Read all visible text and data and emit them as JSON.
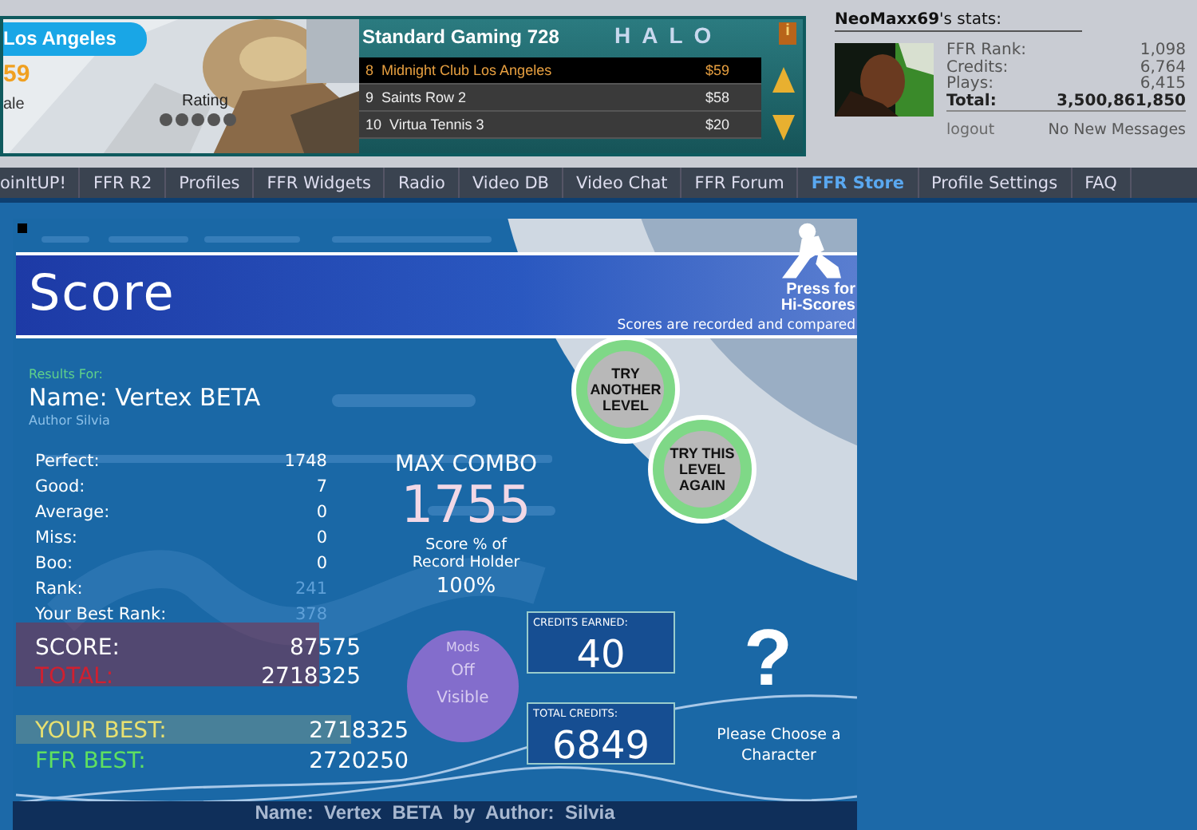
{
  "ad": {
    "tab": "Los Angeles",
    "price": "59",
    "caption": "ale",
    "rating_label": "Rating",
    "stars": 5,
    "title": "Standard Gaming 728",
    "logo": "HALO",
    "info": "i",
    "items": [
      {
        "rank": "8",
        "title": "Midnight Club Los Angeles",
        "price": "$59",
        "selected": true
      },
      {
        "rank": "9",
        "title": "Saints Row 2",
        "price": "$58",
        "selected": false
      },
      {
        "rank": "10",
        "title": "Virtua Tennis 3",
        "price": "$20",
        "selected": false
      }
    ]
  },
  "stats": {
    "heading": "**NeoMaxx69**'s stats:",
    "rows": [
      {
        "label": "FFR Rank:",
        "value": "1,098",
        "kind": "plain"
      },
      {
        "label": "Credits:",
        "value": "6,764",
        "kind": "plain"
      },
      {
        "label": "Plays:",
        "value": "6,415",
        "kind": "plain"
      },
      {
        "label": "Total:",
        "value": "3,500,861,850",
        "kind": "total"
      }
    ],
    "logout": "logout",
    "messages": "No New Messages"
  },
  "nav": [
    {
      "label": "oinItUP!",
      "selected": false
    },
    {
      "label": "FFR R2",
      "selected": false
    },
    {
      "label": "Profiles",
      "selected": false
    },
    {
      "label": "FFR Widgets",
      "selected": false
    },
    {
      "label": "Radio",
      "selected": false
    },
    {
      "label": "Video DB",
      "selected": false
    },
    {
      "label": "Video Chat",
      "selected": false
    },
    {
      "label": "FFR Forum",
      "selected": false
    },
    {
      "label": "FFR Store",
      "selected": true
    },
    {
      "label": "Profile Settings",
      "selected": false
    },
    {
      "label": "FAQ",
      "selected": false
    }
  ],
  "game": {
    "title": "Score",
    "hiscores": "Press for Hi-Scores",
    "recorded": "Scores are recorded and compared",
    "buttons": [
      "TRY ANOTHER LEVEL",
      "TRY THIS LEVEL AGAIN"
    ],
    "results_for": "Results For:",
    "name": "Name: Vertex BETA",
    "author": "Author Silvia",
    "rows": [
      {
        "label": "Perfect:",
        "value": "1748",
        "dim": false
      },
      {
        "label": "Good:",
        "value": "7",
        "dim": false
      },
      {
        "label": "Average:",
        "value": "0",
        "dim": false
      },
      {
        "label": "Miss:",
        "value": "0",
        "dim": false
      },
      {
        "label": "Boo:",
        "value": "0",
        "dim": false
      },
      {
        "label": "Rank:",
        "value": "241",
        "dim": true
      },
      {
        "label": "Your Best Rank:",
        "value": "378",
        "dim": true
      }
    ],
    "combo_label": "MAX COMBO",
    "combo": "1755",
    "record_lines": [
      "Score % of",
      "Record Holder"
    ],
    "record": "100%",
    "totals": [
      {
        "label": "SCORE:",
        "value": "87575",
        "kind": "score"
      },
      {
        "label": "TOTAL:",
        "value": "2718325",
        "kind": "total"
      },
      {
        "label": "YOUR BEST:",
        "value": "2718325",
        "kind": "yourbest"
      },
      {
        "label": "FFR BEST:",
        "value": "2720250",
        "kind": "ffrbest"
      }
    ],
    "mods": {
      "label": "Mods",
      "lines": [
        "Off",
        "Visible"
      ]
    },
    "credits_earned": {
      "label": "CREDITS EARNED:",
      "value": "40"
    },
    "total_credits": {
      "label": "TOTAL CREDITS:",
      "value": "6849"
    },
    "character": {
      "mark": "?",
      "text": "Please Choose a Character"
    },
    "footer": "Name:  Vertex  BETA  by  Author:  Silvia"
  }
}
